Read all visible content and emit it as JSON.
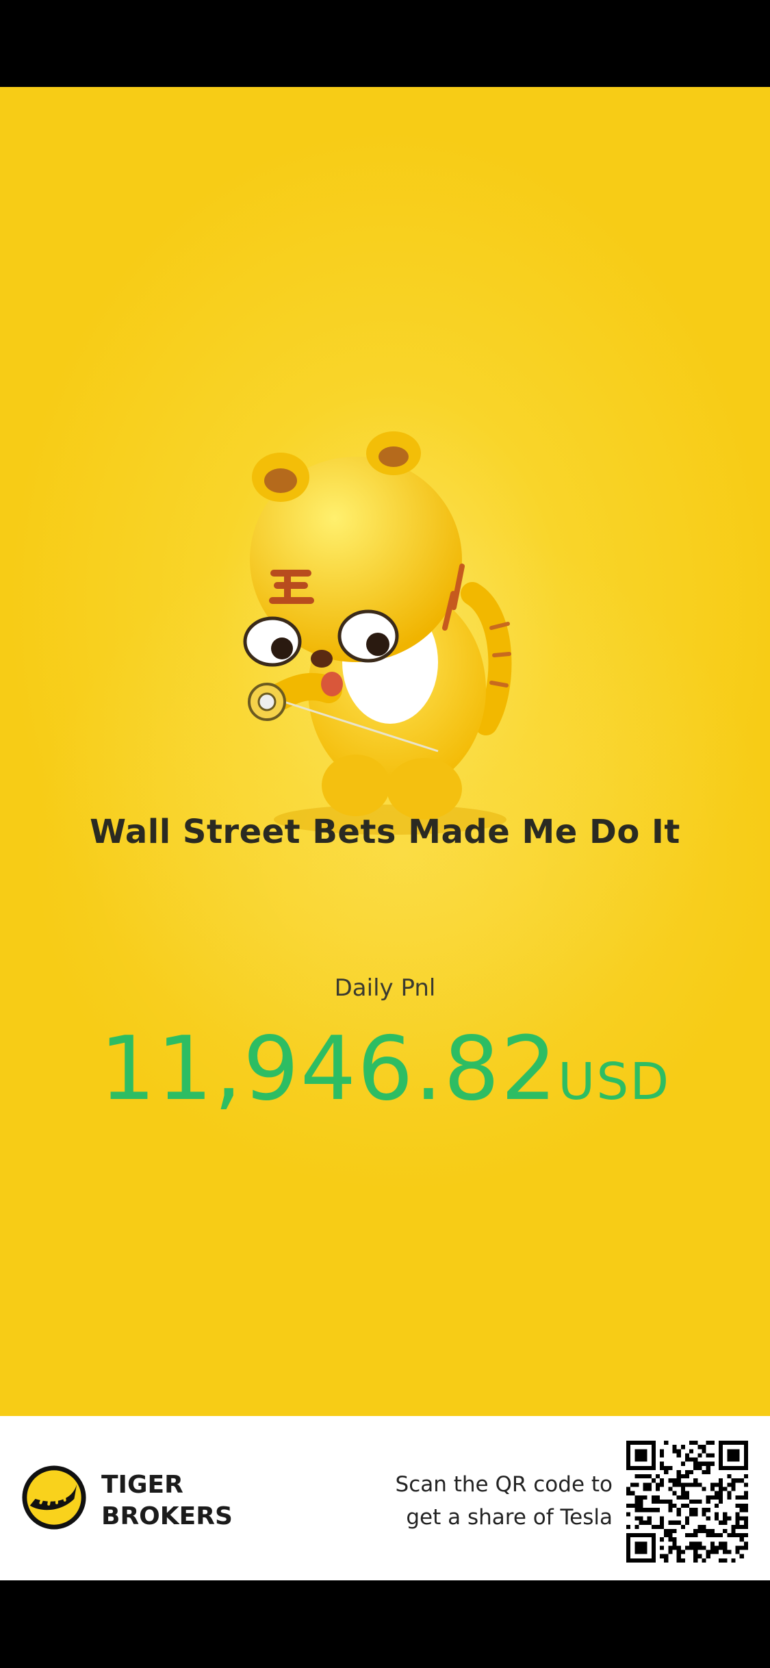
{
  "headline": "Wall Street Bets Made Me Do It",
  "pnl": {
    "label": "Daily Pnl",
    "amount": "11,946.82",
    "currency": "USD",
    "color": "#2dbd63"
  },
  "footer": {
    "brand_line1": "TIGER",
    "brand_line2": "BROKERS",
    "scan_line1": "Scan the QR code to",
    "scan_line2": "get a share of Tesla"
  },
  "icons": {
    "mascot": "tiger-mascot-illustration",
    "logo": "tiger-logo-icon",
    "qr": "qr-code"
  },
  "colors": {
    "background": "#f7cc16",
    "accent_green": "#2dbd63"
  }
}
